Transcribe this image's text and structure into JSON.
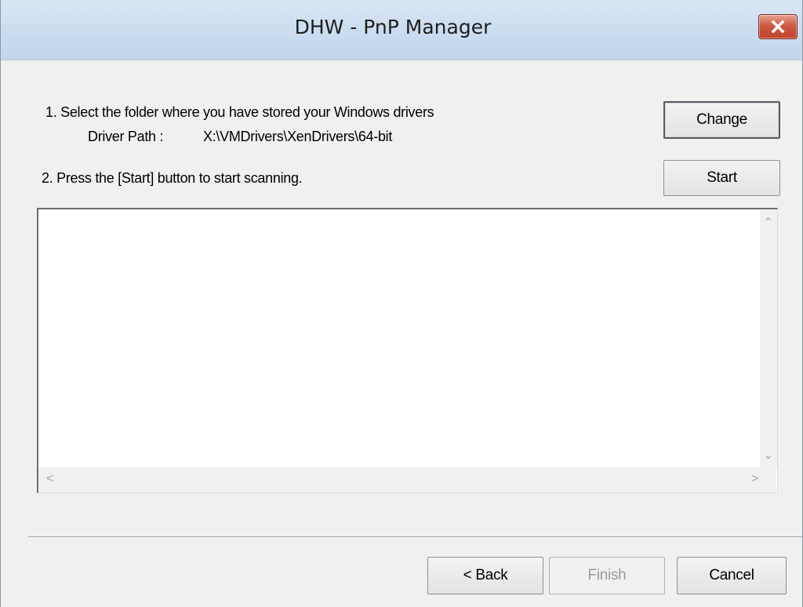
{
  "window": {
    "title": "DHW - PnP Manager"
  },
  "step1": {
    "text": "1. Select the folder where you have stored your Windows drivers",
    "path_label": "Driver Path :",
    "path_value": "X:\\VMDrivers\\XenDrivers\\64-bit",
    "change_label": "Change"
  },
  "step2": {
    "text": "2. Press the [Start] button to start scanning.",
    "start_label": "Start"
  },
  "results": {
    "items": []
  },
  "footer": {
    "back_label": "< Back",
    "finish_label": "Finish",
    "cancel_label": "Cancel"
  }
}
